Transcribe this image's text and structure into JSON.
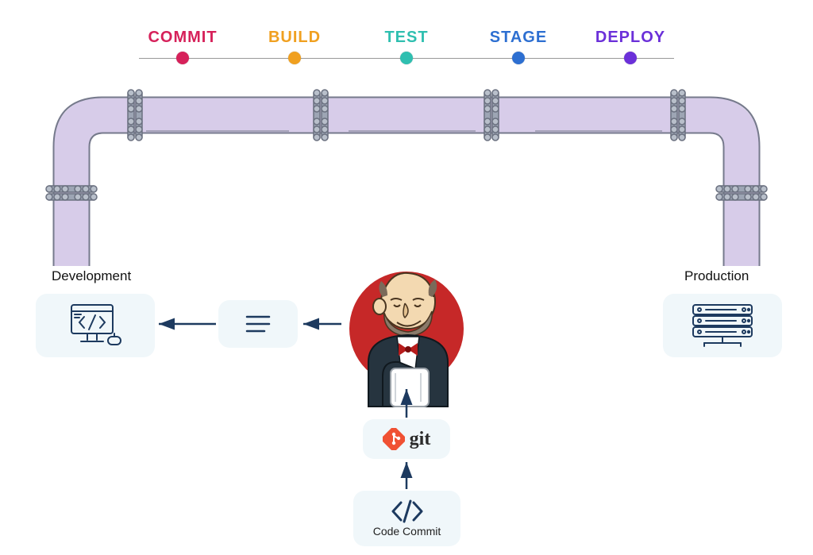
{
  "stages": [
    {
      "label": "COMMIT",
      "color": "#d6215a",
      "dot": "#d6215a"
    },
    {
      "label": "BUILD",
      "color": "#f0a020",
      "dot": "#f0a020"
    },
    {
      "label": "TEST",
      "color": "#2fbfb0",
      "dot": "#2fbfb0"
    },
    {
      "label": "STAGE",
      "color": "#2d6fd1",
      "dot": "#2d6fd1"
    },
    {
      "label": "DEPLOY",
      "color": "#6b30d9",
      "dot": "#6b30d9"
    }
  ],
  "development_label": "Development",
  "production_label": "Production",
  "git_label": "git",
  "code_commit_label": "Code Commit",
  "icons": {
    "jenkins": "jenkins-logo",
    "git": "git-logo",
    "code": "code-brackets-icon",
    "dev": "dev-workstation-icon",
    "prod": "server-rack-icon",
    "file": "document-lines-icon"
  },
  "colors": {
    "stroke": "#1d3a5f",
    "card_bg": "#f0f7fa",
    "pipe_fill": "#d7cce9",
    "pipe_stroke": "#767a8c",
    "jenkins_red": "#c62828",
    "git_orange": "#f05133"
  }
}
